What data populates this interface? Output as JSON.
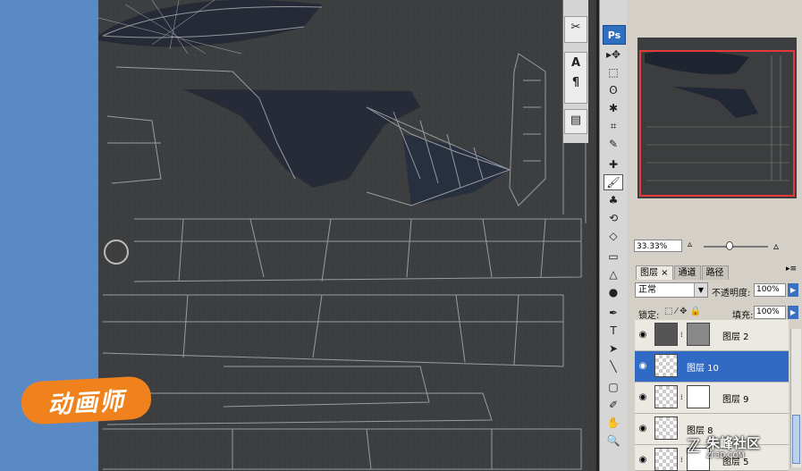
{
  "app": {
    "logo": "Ps"
  },
  "mini_palette": {
    "buttons": [
      "✂",
      "A",
      "¶",
      "▤"
    ]
  },
  "toolbox": {
    "tools": [
      "move-icon",
      "marquee-icon",
      "lasso-icon",
      "magic-wand-icon",
      "crop-icon",
      "slice-icon",
      "healing-icon",
      "brush-icon",
      "stamp-icon",
      "history-brush-icon",
      "eraser-icon",
      "gradient-icon",
      "blur-icon",
      "dodge-icon",
      "pen-icon",
      "type-icon",
      "path-select-icon",
      "line-icon",
      "notes-icon",
      "eyedropper-icon",
      "hand-icon",
      "zoom-icon"
    ],
    "glyphs": [
      "▸✥",
      "⬚",
      "ʘ",
      "✱",
      "⌗",
      "✎",
      "✚",
      "🖌",
      "♣",
      "⟲",
      "◇",
      "▭",
      "△",
      "●",
      "✒",
      "T",
      "➤",
      "╲",
      "▢",
      "✐",
      "✋",
      "🔍"
    ]
  },
  "navigator": {
    "zoom": "33.33%"
  },
  "layers_panel": {
    "tabs": [
      "图层 ×",
      "通道",
      "路径"
    ],
    "blend_mode": "正常",
    "opacity_label": "不透明度:",
    "opacity": "100%",
    "lock_label": "锁定:",
    "fill_label": "填充:",
    "fill": "100%",
    "layers": [
      {
        "name": "图层 2",
        "selected": false
      },
      {
        "name": "图层 10",
        "selected": true
      },
      {
        "name": "图层 9",
        "selected": false
      },
      {
        "name": "图层 8",
        "selected": false
      },
      {
        "name": "图层 5",
        "selected": false
      }
    ]
  },
  "overlay": {
    "logo_text": "动画师",
    "watermark": "朱峰社区",
    "watermark_sub": "ZF3D.COM"
  }
}
